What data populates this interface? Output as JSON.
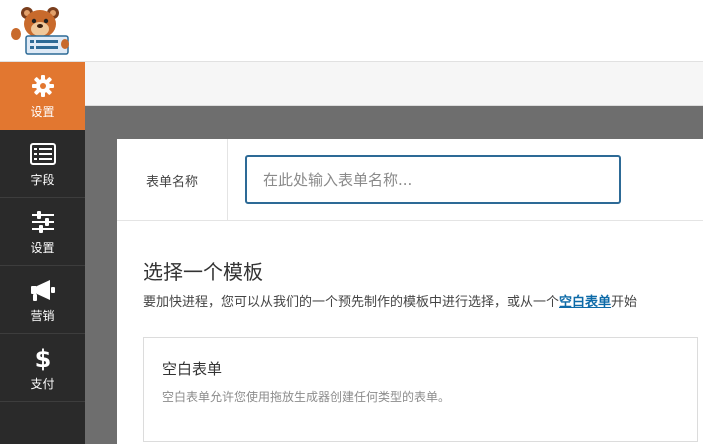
{
  "sidebar": {
    "items": [
      {
        "label": "设置",
        "icon": "gear-icon",
        "active": true
      },
      {
        "label": "字段",
        "icon": "fields-list-icon",
        "active": false
      },
      {
        "label": "设置",
        "icon": "sliders-icon",
        "active": false
      },
      {
        "label": "营销",
        "icon": "megaphone-icon",
        "active": false
      },
      {
        "label": "支付",
        "icon": "dollar-icon",
        "active": false
      }
    ],
    "colors": {
      "background": "#2a2a2a",
      "active": "#e27730"
    }
  },
  "form_name": {
    "label": "表单名称",
    "value": "",
    "placeholder": "在此处输入表单名称..."
  },
  "templates": {
    "title": "选择一个模板",
    "description_before": "要加快进程，您可以从我们的一个预先制作的模板中进行选择，或从一个",
    "description_link": "空白表单",
    "description_after": "开始",
    "cards": [
      {
        "title": "空白表单",
        "description": "空白表单允许您使用拖放生成器创建任何类型的表单。"
      }
    ]
  }
}
